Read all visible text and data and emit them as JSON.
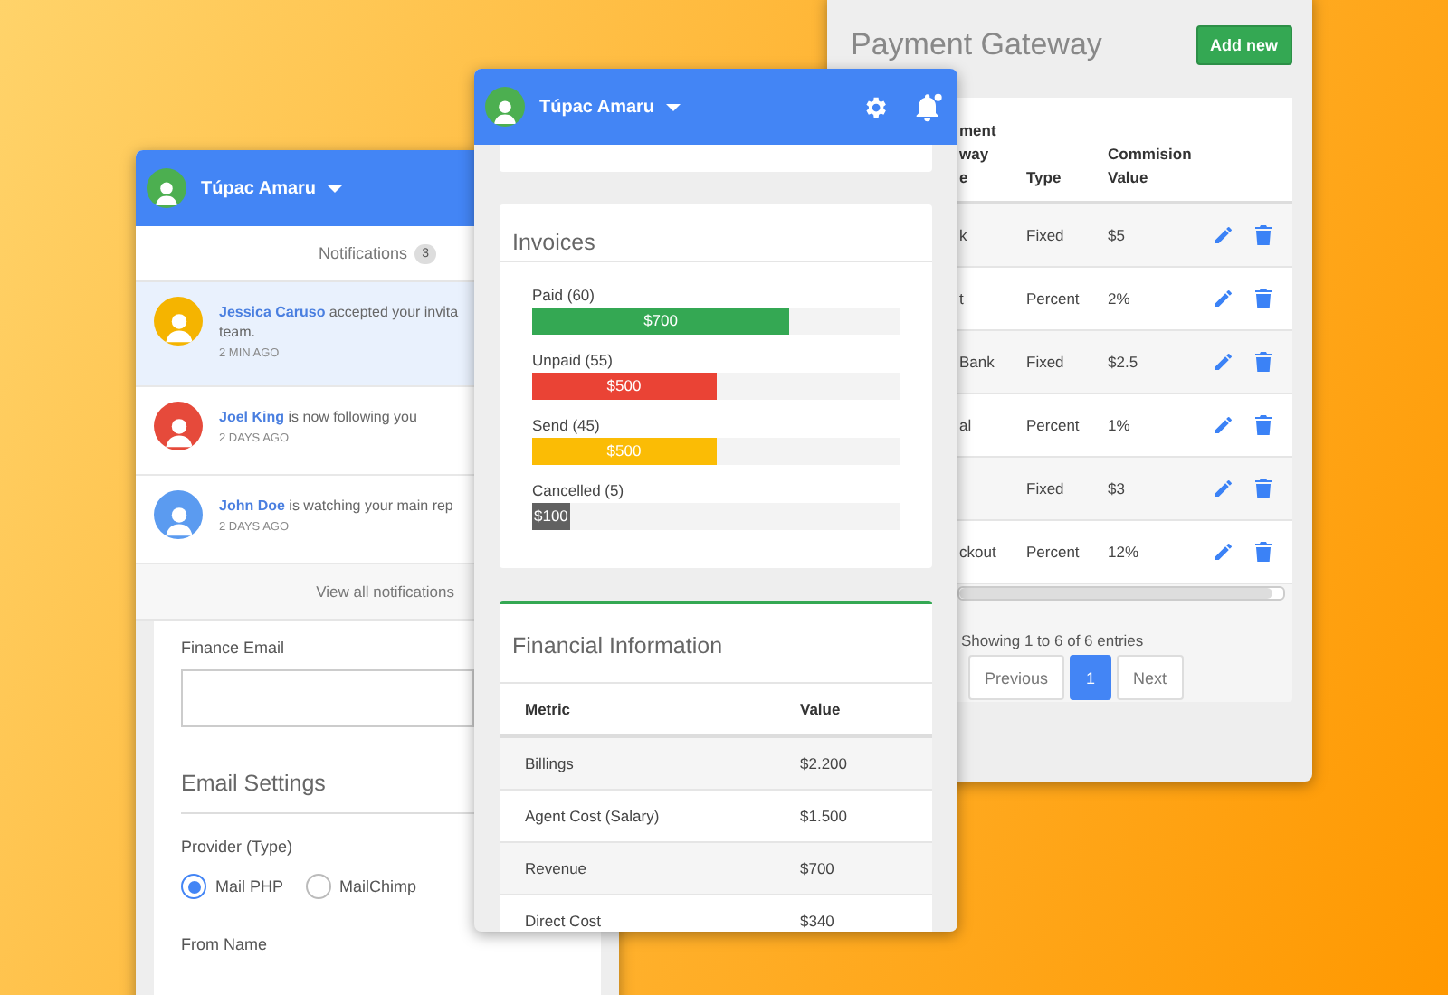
{
  "payment_window": {
    "title": "Payment Gateway",
    "add_button": "Add new",
    "columns": [
      {
        "lines": [
          "ment",
          "way",
          "e"
        ]
      },
      {
        "label": "Type"
      },
      {
        "label": "Commision Value"
      }
    ],
    "rows": [
      {
        "name": "k",
        "type": "Fixed",
        "value": "$5"
      },
      {
        "name": "t",
        "type": "Percent",
        "value": "2%"
      },
      {
        "name": "Bank",
        "type": "Fixed",
        "value": "$2.5"
      },
      {
        "name": "al",
        "type": "Percent",
        "value": "1%"
      },
      {
        "type": "Fixed",
        "value": "$3"
      },
      {
        "name": "ckout",
        "type": "Percent",
        "value": "12%"
      }
    ],
    "summary": "Showing 1 to 6 of 6 entries",
    "pages": [
      {
        "label": "Previous",
        "selected": false
      },
      {
        "label": "1",
        "selected": true
      },
      {
        "label": "Next",
        "selected": false
      }
    ]
  },
  "notifications_window": {
    "user": "Túpac Amaru",
    "title": "Notifications",
    "count": "3",
    "items": [
      {
        "name": "Jessica Caruso",
        "lines": [
          "accepted your invita",
          "team."
        ],
        "time": "2 MIN AGO",
        "unread": true,
        "color": "#f5b400"
      },
      {
        "name": "Joel King",
        "lines": [
          "is now following you"
        ],
        "time": "2 DAYS AGO",
        "unread": false,
        "color": "#e64a3b"
      },
      {
        "name": "John Doe",
        "lines": [
          "is watching your main rep"
        ],
        "time": "2 DAYS AGO",
        "unread": false,
        "color": "#5b9bf0"
      }
    ],
    "view_all": "View all notifications",
    "form": {
      "finance_email_label": "Finance Email",
      "email_settings_title": "Email Settings",
      "provider_label": "Provider (Type)",
      "providers": [
        {
          "label": "Mail PHP",
          "selected": true
        },
        {
          "label": "MailChimp",
          "selected": false
        }
      ],
      "from_name_label": "From Name"
    }
  },
  "dashboard_window": {
    "user": "Túpac Amaru",
    "invoices": {
      "title": "Invoices",
      "bars": [
        {
          "label": "Paid (60)",
          "amount": "$700",
          "level": 0.7,
          "color": "#34a853"
        },
        {
          "label": "Unpaid (55)",
          "amount": "$500",
          "level": 0.5,
          "color": "#ea4335"
        },
        {
          "label": "Send (45)",
          "amount": "$500",
          "level": 0.5,
          "color": "#fbbc05"
        },
        {
          "label": "Cancelled (5)",
          "amount": "$100",
          "level": 0.1,
          "color": "#616161"
        }
      ]
    },
    "financial": {
      "title": "Financial Information",
      "columns": [
        "Metric",
        "Value"
      ],
      "rows": [
        {
          "metric": "Billings",
          "value": "$2.200"
        },
        {
          "metric": "Agent Cost (Salary)",
          "value": "$1.500"
        },
        {
          "metric": "Revenue",
          "value": "$700"
        },
        {
          "metric": "Direct Cost",
          "value": "$340"
        }
      ]
    }
  }
}
